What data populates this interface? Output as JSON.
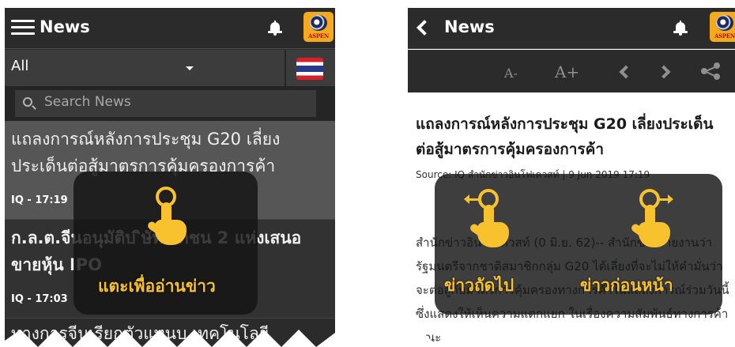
{
  "left": {
    "header": {
      "title": "News"
    },
    "filter": {
      "category": "All"
    },
    "search": {
      "placeholder": "Search News"
    },
    "items": [
      {
        "headline": "แถลงการณ์หลังการประชุม G20 เลี่ยงประเด็นต่อสู้มาตรการคุ้มครองการค้า",
        "meta": "IQ - 17:19"
      },
      {
        "headline": "ก.ล.ต.จีนอนุมัติบ ิษัทเอกชน 2 แห่งเสนอขายหุ้น IPO",
        "meta": "IQ - 17:03"
      },
      {
        "headline": "ทางการจีนเรียกตัวแทนบ.เทคโนโลยี"
      }
    ],
    "hint": "แตะเพื่ออ่านข่าว"
  },
  "right": {
    "header": {
      "title": "News"
    },
    "toolbar": {
      "font_minus": "A-",
      "font_plus": "A+"
    },
    "article": {
      "headline": "แถลงการณ์หลังการประชุม G20 เลี่ยงประเด็นต่อสู้มาตรการคุ้มครองการค้า",
      "source": "Source: IQ สำนักข่าวอินโฟเควสท์ | 9 Jun 2019 17:19",
      "body": "สำนักข่าวอินโฟเควสท์ (0 มิ.ย. 62)-- สำนักข่าวรายงานว่า รัฐมนตรีจากชาติสมาชิกกลุ่ม G20 ได้เลี่ยงที่จะไม่ให้คำมั่นว่าจะต่อสู้กับมาตรการคุ้มครองทางการค้าในแถลงการณ์ร่วมวันนี้ ซึ่งแสดงให้เห็นความแตกแยก ในเรื่องความสัมพันธ์ทางการค้า ขณะ"
    },
    "hint_next": "ข่าวถัดไป",
    "hint_prev": "ข่าวก่อนหน้า"
  },
  "logo_text": "ASPEN",
  "colors": {
    "accent": "#f8c22e",
    "header": "#2b2b2b",
    "logo": "#f4a91f"
  }
}
